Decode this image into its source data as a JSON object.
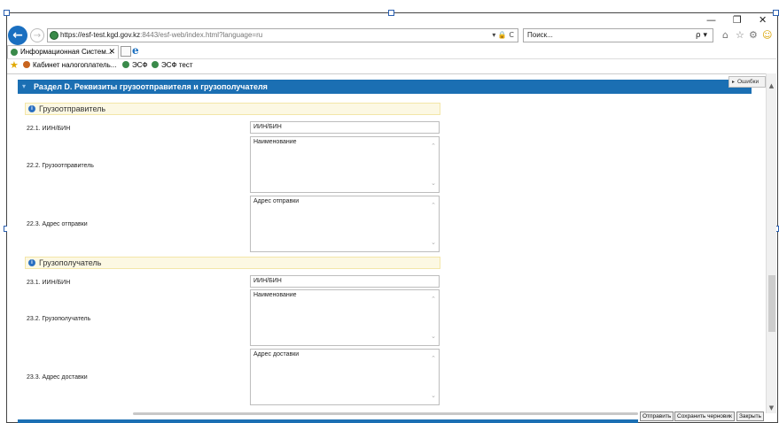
{
  "window": {
    "minimize": "—",
    "restore": "❐",
    "close": "✕"
  },
  "browser": {
    "url_host": "https://esf-test.kgd.gov.kz",
    "url_rest": ":8443/esf-web/index.html?language=ru",
    "url_tools": "▾ 🔒 C",
    "search_placeholder": "Поиск...",
    "search_tools": "ρ ▾",
    "tab_title": "Информационная Систем...",
    "tab_close": "✕"
  },
  "favorites": [
    {
      "label": "Кабинет налогоплатель..."
    },
    {
      "label": "ЭСФ"
    },
    {
      "label": "ЭСФ тест"
    }
  ],
  "section": {
    "title": "Раздел D. Реквизиты грузоотправителя и грузополучателя",
    "errors_label": "Ошибки"
  },
  "shipper": {
    "group_title": "Грузоотправитель",
    "iin_label": "22.1. ИИН/БИН",
    "iin_placeholder": "ИИН/БИН",
    "name_label": "22.2. Грузоотправитель",
    "name_placeholder": "Наименование",
    "address_label": "22.3. Адрес отправки",
    "address_placeholder": "Адрес отправки"
  },
  "consignee": {
    "group_title": "Грузополучатель",
    "iin_label": "23.1. ИИН/БИН",
    "iin_placeholder": "ИИН/БИН",
    "name_label": "23.2. Грузополучатель",
    "name_placeholder": "Наименование",
    "address_label": "23.3. Адрес доставки",
    "address_placeholder": "Адрес доставки"
  },
  "actions": {
    "send": "Отправить",
    "save_draft": "Сохранить черновик",
    "close": "Закрыть"
  }
}
